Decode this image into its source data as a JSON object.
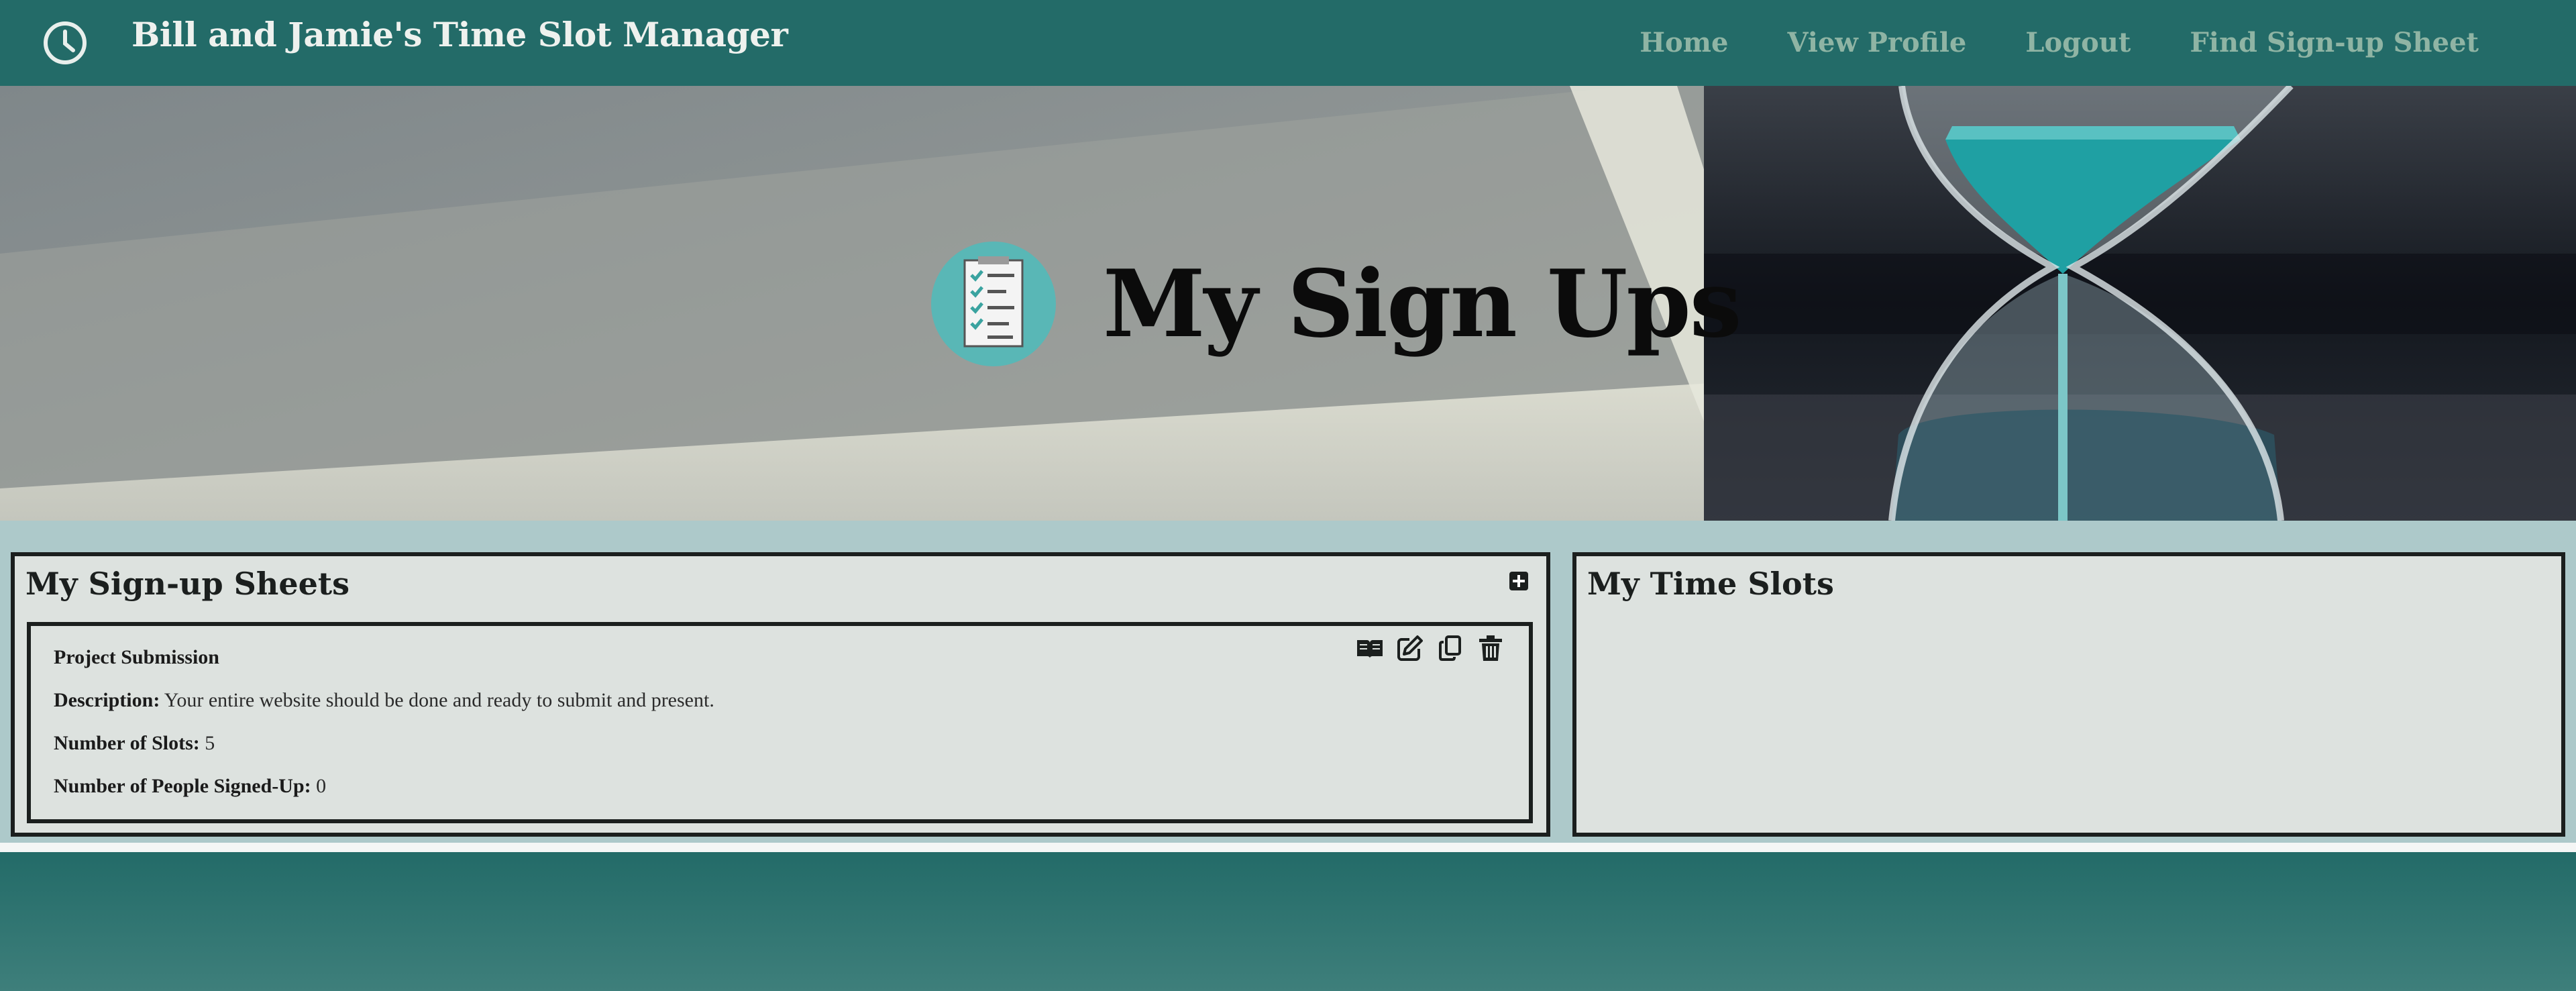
{
  "navbar": {
    "title": "Bill and Jamie's Time Slot Manager",
    "links": [
      "Home",
      "View Profile",
      "Logout",
      "Find Sign-up Sheet"
    ]
  },
  "hero": {
    "title": "My Sign Ups",
    "badge_icon": "checklist-icon"
  },
  "sheets_panel": {
    "title": "My Sign-up Sheets",
    "add_icon": "plus-square-icon",
    "card": {
      "name": "Project Submission",
      "description_label": "Description:",
      "description": "Your entire website should be done and ready to submit and present.",
      "slots_label": "Number of Slots:",
      "slots": "5",
      "signed_label": "Number of People Signed-Up:",
      "signed": "0",
      "actions": [
        "book-open-icon",
        "edit-icon",
        "copy-icon",
        "trash-icon"
      ]
    }
  },
  "slots_panel": {
    "title": "My Time Slots"
  },
  "colors": {
    "nav_bg": "#236b68",
    "nav_link": "#8fb4a4",
    "page_bg": "#adc9ca",
    "panel_bg": "#dde2df",
    "teal_accent": "#1fa0a3"
  }
}
